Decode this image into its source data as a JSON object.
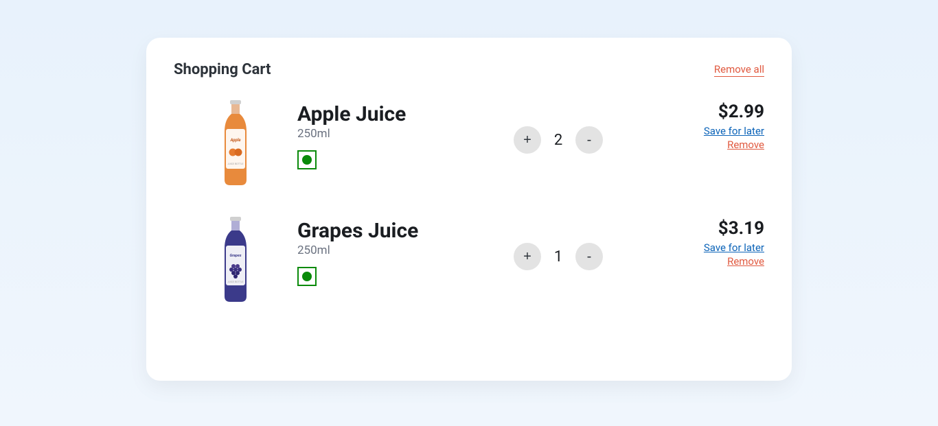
{
  "header": {
    "title": "Shopping Cart",
    "remove_all_label": "Remove all"
  },
  "items": [
    {
      "name": "Apple Juice",
      "size": "250ml",
      "quantity": "2",
      "price": "$2.99",
      "save_label": "Save for later",
      "remove_label": "Remove",
      "bottle_color": "#e88a3c",
      "veg": true
    },
    {
      "name": "Grapes Juice",
      "size": "250ml",
      "quantity": "1",
      "price": "$3.19",
      "save_label": "Save for later",
      "remove_label": "Remove",
      "bottle_color": "#3b3a8a",
      "veg": true
    }
  ],
  "qty_plus_label": "+",
  "qty_minus_label": "-"
}
